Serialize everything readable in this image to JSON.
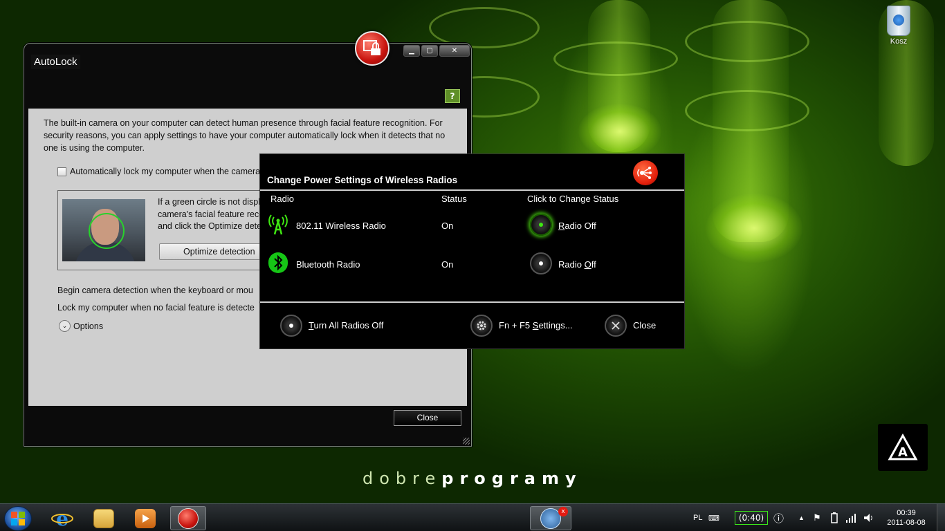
{
  "desktop": {
    "recycle_bin_label": "Kosz",
    "brand_thin": "dobre",
    "brand_bold": "programy"
  },
  "autolock": {
    "title": "AutoLock",
    "intro": "The built-in camera on your computer can detect human presence through facial feature recognition. For security reasons, you can apply settings to have your computer automatically lock when it detects that no one is using the computer.",
    "auto_lock_label": "Automatically lock my computer when the camera",
    "auto_lock_checked": false,
    "cam_text_1": "If a green circle is not displ",
    "cam_text_2": "camera's facial feature reco",
    "cam_text_3": "and click the Optimize detec",
    "optimize_label": "Optimize detection",
    "begin_label": "Begin camera detection when the keyboard or mou",
    "lock_label": "Lock my computer when no facial feature is detecte",
    "options_label": "Options",
    "close_label": "Close"
  },
  "radios": {
    "title": "Change Power Settings of Wireless Radios",
    "headers": {
      "radio": "Radio",
      "status": "Status",
      "action": "Click to Change Status"
    },
    "rows": [
      {
        "name": "802.11 Wireless Radio",
        "status": "On",
        "action_pre": "",
        "action_u": "R",
        "action_post": "adio Off"
      },
      {
        "name": "Bluetooth Radio",
        "status": "On",
        "action_pre": "Radio ",
        "action_u": "O",
        "action_post": "ff"
      }
    ],
    "turn_all_u": "T",
    "turn_all_rest": "urn All Radios Off",
    "fn_pre": "Fn + F5 ",
    "fn_u": "S",
    "fn_post": "ettings...",
    "close_label": "Close"
  },
  "taskbar": {
    "language": "PL",
    "battery": "(0:40)",
    "time": "00:39",
    "date": "2011-08-08"
  }
}
